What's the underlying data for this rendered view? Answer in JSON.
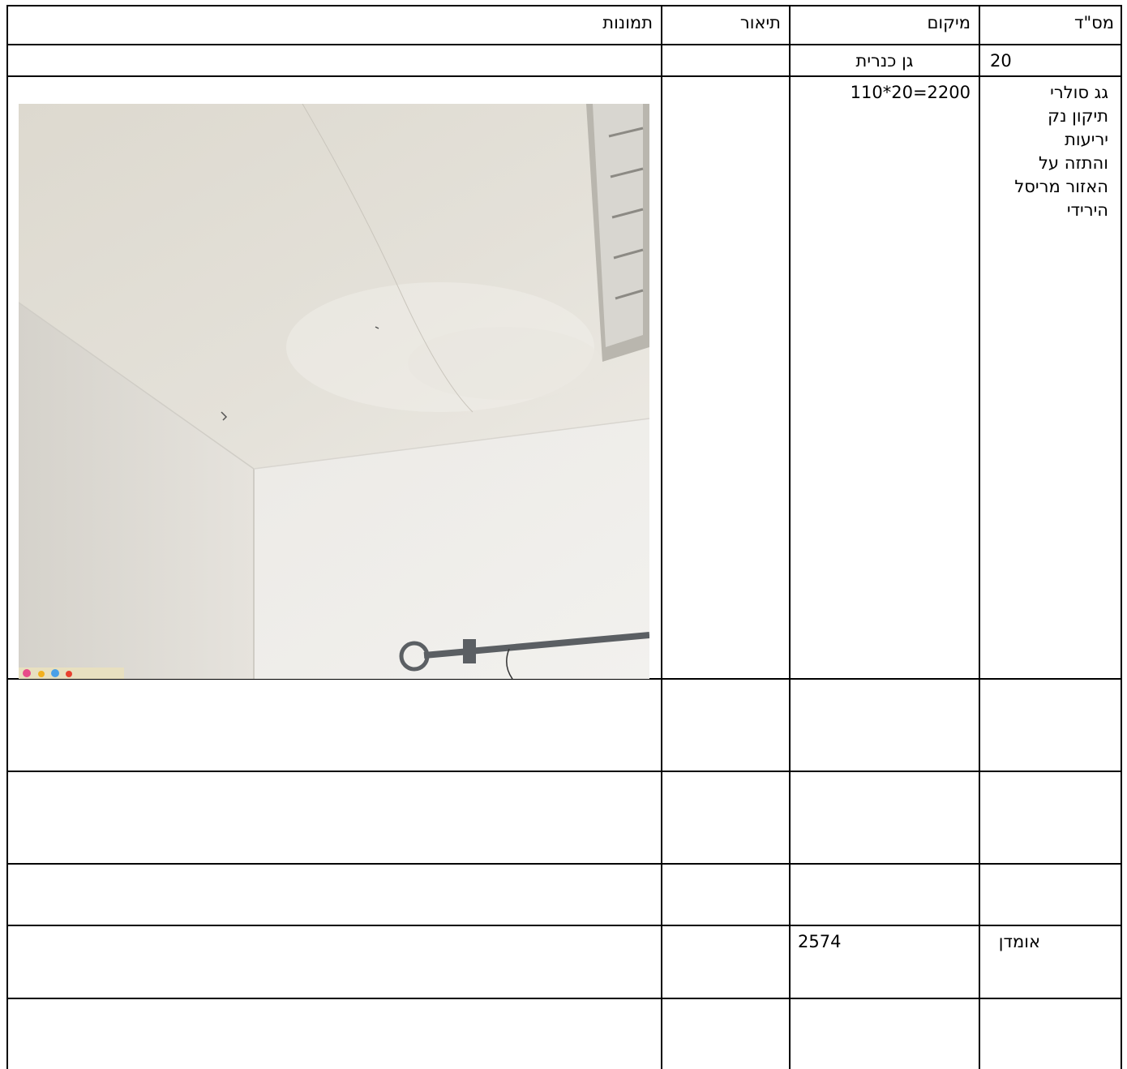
{
  "table": {
    "headers": {
      "num": "מס\"ד",
      "location": "מיקום",
      "description": "תיאור",
      "pictures": "תמונות"
    },
    "row1": {
      "num": "20",
      "location": "גן כנרית"
    },
    "row2": {
      "item_lines": [
        "גג סולרי",
        "תיקון נק",
        "יריעות",
        "והתזה על",
        "האזור מריסל",
        "הירידי"
      ],
      "location": "110*20=2200",
      "photo_alt": "ceiling with moisture stain"
    },
    "estimate_row": {
      "label": "אומדן",
      "value": "2574"
    }
  }
}
